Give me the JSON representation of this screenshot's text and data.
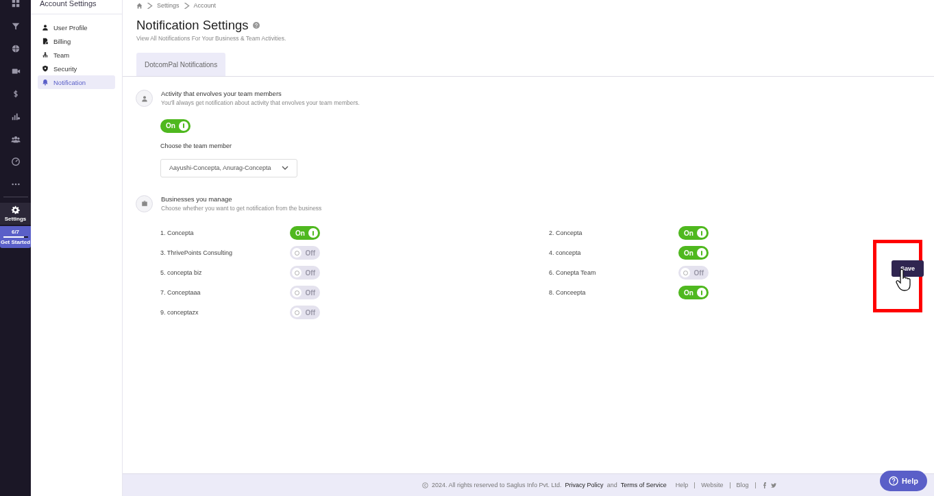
{
  "rail": {
    "settings": {
      "label": "Settings",
      "selected": true
    },
    "progress": {
      "count": "6/7",
      "level": 0.86,
      "label": "Get Started"
    }
  },
  "sidebar": {
    "title": "Account Settings",
    "items": [
      {
        "label": "User Profile",
        "selected": false
      },
      {
        "label": "Billing",
        "selected": false
      },
      {
        "label": "Team",
        "selected": false
      },
      {
        "label": "Security",
        "selected": false
      },
      {
        "label": "Notification",
        "selected": true
      }
    ]
  },
  "breadcrumb": [
    "Settings",
    "Account"
  ],
  "title": "Notification Settings",
  "subtitle": "View All Notifications For Your Business & Team Activities.",
  "tabs": [
    {
      "label": "DotcomPal Notifications",
      "selected": true
    }
  ],
  "activity": {
    "title": "Activity that envolves your team members",
    "description": "You'll always get notification about activity that envolves your team members.",
    "toggle": {
      "on": true,
      "label": "On"
    },
    "member_label": "Choose the team member",
    "member_value": "Aayushi-Concepta, Anurag-Concepta"
  },
  "businesses_section": {
    "title": "Businesses you manage",
    "description": "Choose whether you want to get notification from the business"
  },
  "businesses": [
    {
      "name": "1. Concepta",
      "on": true,
      "label": "On"
    },
    {
      "name": "2. Concepta",
      "on": true,
      "label": "On"
    },
    {
      "name": "3. ThrivePoints Consulting",
      "on": false,
      "label": "Off"
    },
    {
      "name": "4. concepta",
      "on": true,
      "label": "On"
    },
    {
      "name": "5. concepta biz",
      "on": false,
      "label": "Off"
    },
    {
      "name": "6. Conepta Team",
      "on": false,
      "label": "Off"
    },
    {
      "name": "7. Conceptaaa",
      "on": false,
      "label": "Off"
    },
    {
      "name": "8. Conceepta",
      "on": true,
      "label": "On"
    },
    {
      "name": "9. conceptazx",
      "on": false,
      "label": "Off"
    }
  ],
  "save_button": "Save",
  "footer": {
    "copyright": "2024. All rights reserved to Saglus Info Pvt. Ltd.",
    "privacy": "Privacy Policy",
    "and": "and",
    "terms": "Terms of Service",
    "links": [
      "Help",
      "Website",
      "Blog"
    ]
  },
  "help_button": "Help"
}
